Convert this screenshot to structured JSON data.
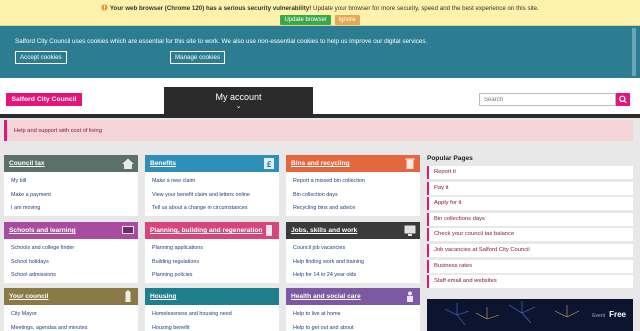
{
  "browser_update": {
    "bold_text": "Your web browser (Chrome 120) has a serious security vulnerability!",
    "text": "Update your browser for more security, speed and the best experience on this site.",
    "update_label": "Update browser",
    "ignore_label": "Ignore",
    "icon": "warning-icon"
  },
  "cookie_banner": {
    "text": "Salford City Council uses cookies which are essential for this site to work. We also use non-essential cookies to help us improve our digital services.",
    "accept_label": "Accept cookies",
    "manage_label": "Manage cookies"
  },
  "header": {
    "logo": "Salford City Council",
    "my_account": "My account",
    "chevron": "⌄",
    "search_placeholder": "Search",
    "search_icon": "search-icon"
  },
  "alert": {
    "link": "Help and support with cost of living"
  },
  "cards": [
    {
      "title": "Council tax",
      "color": "#5a7068",
      "icon": "house-icon",
      "links": [
        "My bill",
        "Make a payment",
        "I am moving"
      ]
    },
    {
      "title": "Benefits",
      "color": "#2e8fb8",
      "icon": "pound-icon",
      "links": [
        "Make a new claim",
        "View your benefit claim and letters online",
        "Tell us about a change in circumstances"
      ]
    },
    {
      "title": "Bins and recycling",
      "color": "#e3673e",
      "icon": "bin-icon",
      "links": [
        "Report a missed bin collection",
        "Bin collection days",
        "Recycling bins and advice"
      ]
    },
    {
      "title": "Schools and learning",
      "color": "#a94c9f",
      "icon": "blackboard-icon",
      "links": [
        "Schools and college finder",
        "School holidays",
        "School admissions"
      ]
    },
    {
      "title": "Planning, building and regeneration",
      "color": "#d6467a",
      "icon": "building-icon",
      "links": [
        "Planning applications",
        "Building regulations",
        "Planning policies"
      ]
    },
    {
      "title": "Jobs, skills and work",
      "color": "#3a3a3a",
      "icon": "computer-icon",
      "links": [
        "Council job vacancies",
        "Help finding work and training",
        "Help for 14 to 24 year olds"
      ]
    },
    {
      "title": "Your council",
      "color": "#8a7a45",
      "icon": "tower-icon",
      "links": [
        "City Mayor",
        "Meetings, agendas and minutes"
      ]
    },
    {
      "title": "Housing",
      "color": "#1f7f8c",
      "icon": "house-icon",
      "links": [
        "Homelessness and housing need",
        "Housing benefit"
      ]
    },
    {
      "title": "Health and social care",
      "color": "#7d58a3",
      "icon": "care-icon",
      "links": [
        "Help to live at home",
        "Help to get out and about"
      ]
    }
  ],
  "popular": {
    "heading": "Popular Pages",
    "items": [
      "Report it",
      "Pay it",
      "Apply for it",
      "Bin collections days",
      "Check your council tax balance",
      "Job vacancies at Salford City Council",
      "Business rates",
      "Staff email and websites"
    ]
  },
  "promo": {
    "label": "Free",
    "sub": "Event"
  }
}
